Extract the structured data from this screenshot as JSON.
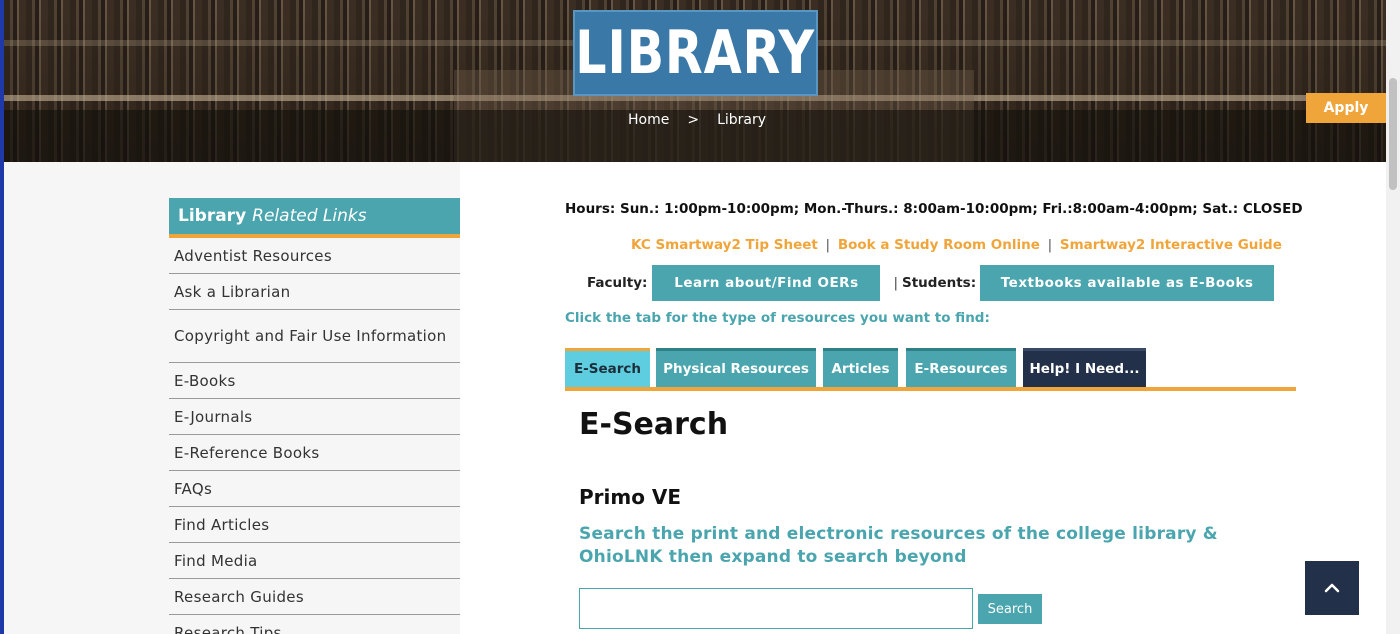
{
  "hero": {
    "title": "LIBRARY",
    "breadcrumb": [
      {
        "label": "Home"
      },
      {
        "separator": ">"
      },
      {
        "label": "Library"
      }
    ],
    "apply_label": "Apply"
  },
  "sidebar": {
    "heading_bold": "Library",
    "heading_italic": "Related Links",
    "items": [
      {
        "label": "Adventist Resources"
      },
      {
        "label": "Ask a Librarian"
      },
      {
        "label": "Copyright and Fair Use Information"
      },
      {
        "label": "E-Books"
      },
      {
        "label": "E-Journals"
      },
      {
        "label": "E-Reference Books"
      },
      {
        "label": "FAQs"
      },
      {
        "label": "Find Articles"
      },
      {
        "label": "Find Media"
      },
      {
        "label": "Research Guides"
      },
      {
        "label": "Research Tips"
      }
    ]
  },
  "main": {
    "hours": "Hours: Sun.: 1:00pm-10:00pm; Mon.-Thurs.: 8:00am-10:00pm; Fri.:8:00am-4:00pm; Sat.: CLOSED",
    "quick_links": [
      {
        "label": "KC Smartway2 Tip Sheet"
      },
      {
        "label": "Book a Study Room Online"
      },
      {
        "label": "Smartway2 Interactive Guide"
      }
    ],
    "link_separator": "|",
    "faculty_label": "Faculty:",
    "faculty_button": "Learn about/Find OERs",
    "students_sep": "|",
    "students_label": "Students:",
    "students_button": "Textbooks available as E-Books",
    "instruction": "Click the tab for the type of resources you want to find:",
    "tabs": [
      {
        "label": "E-Search",
        "active": true
      },
      {
        "label": "Physical Resources"
      },
      {
        "label": "Articles"
      },
      {
        "label": "E-Resources"
      },
      {
        "label": "Help! I Need..."
      }
    ],
    "panel_title": "E-Search",
    "section_title": "Primo VE",
    "section_desc": "Search the print and electronic resources of the college library & OhioLNK then expand to search beyond",
    "search": {
      "value": "",
      "button_label": "Search"
    }
  },
  "back_to_top": {
    "icon": "chevron-up-icon"
  },
  "colors": {
    "teal": "#4aa5ae",
    "orange": "#f0a53a",
    "navy": "#233049",
    "light_teal": "#5fcde0",
    "title_blue": "#3a78a8"
  }
}
